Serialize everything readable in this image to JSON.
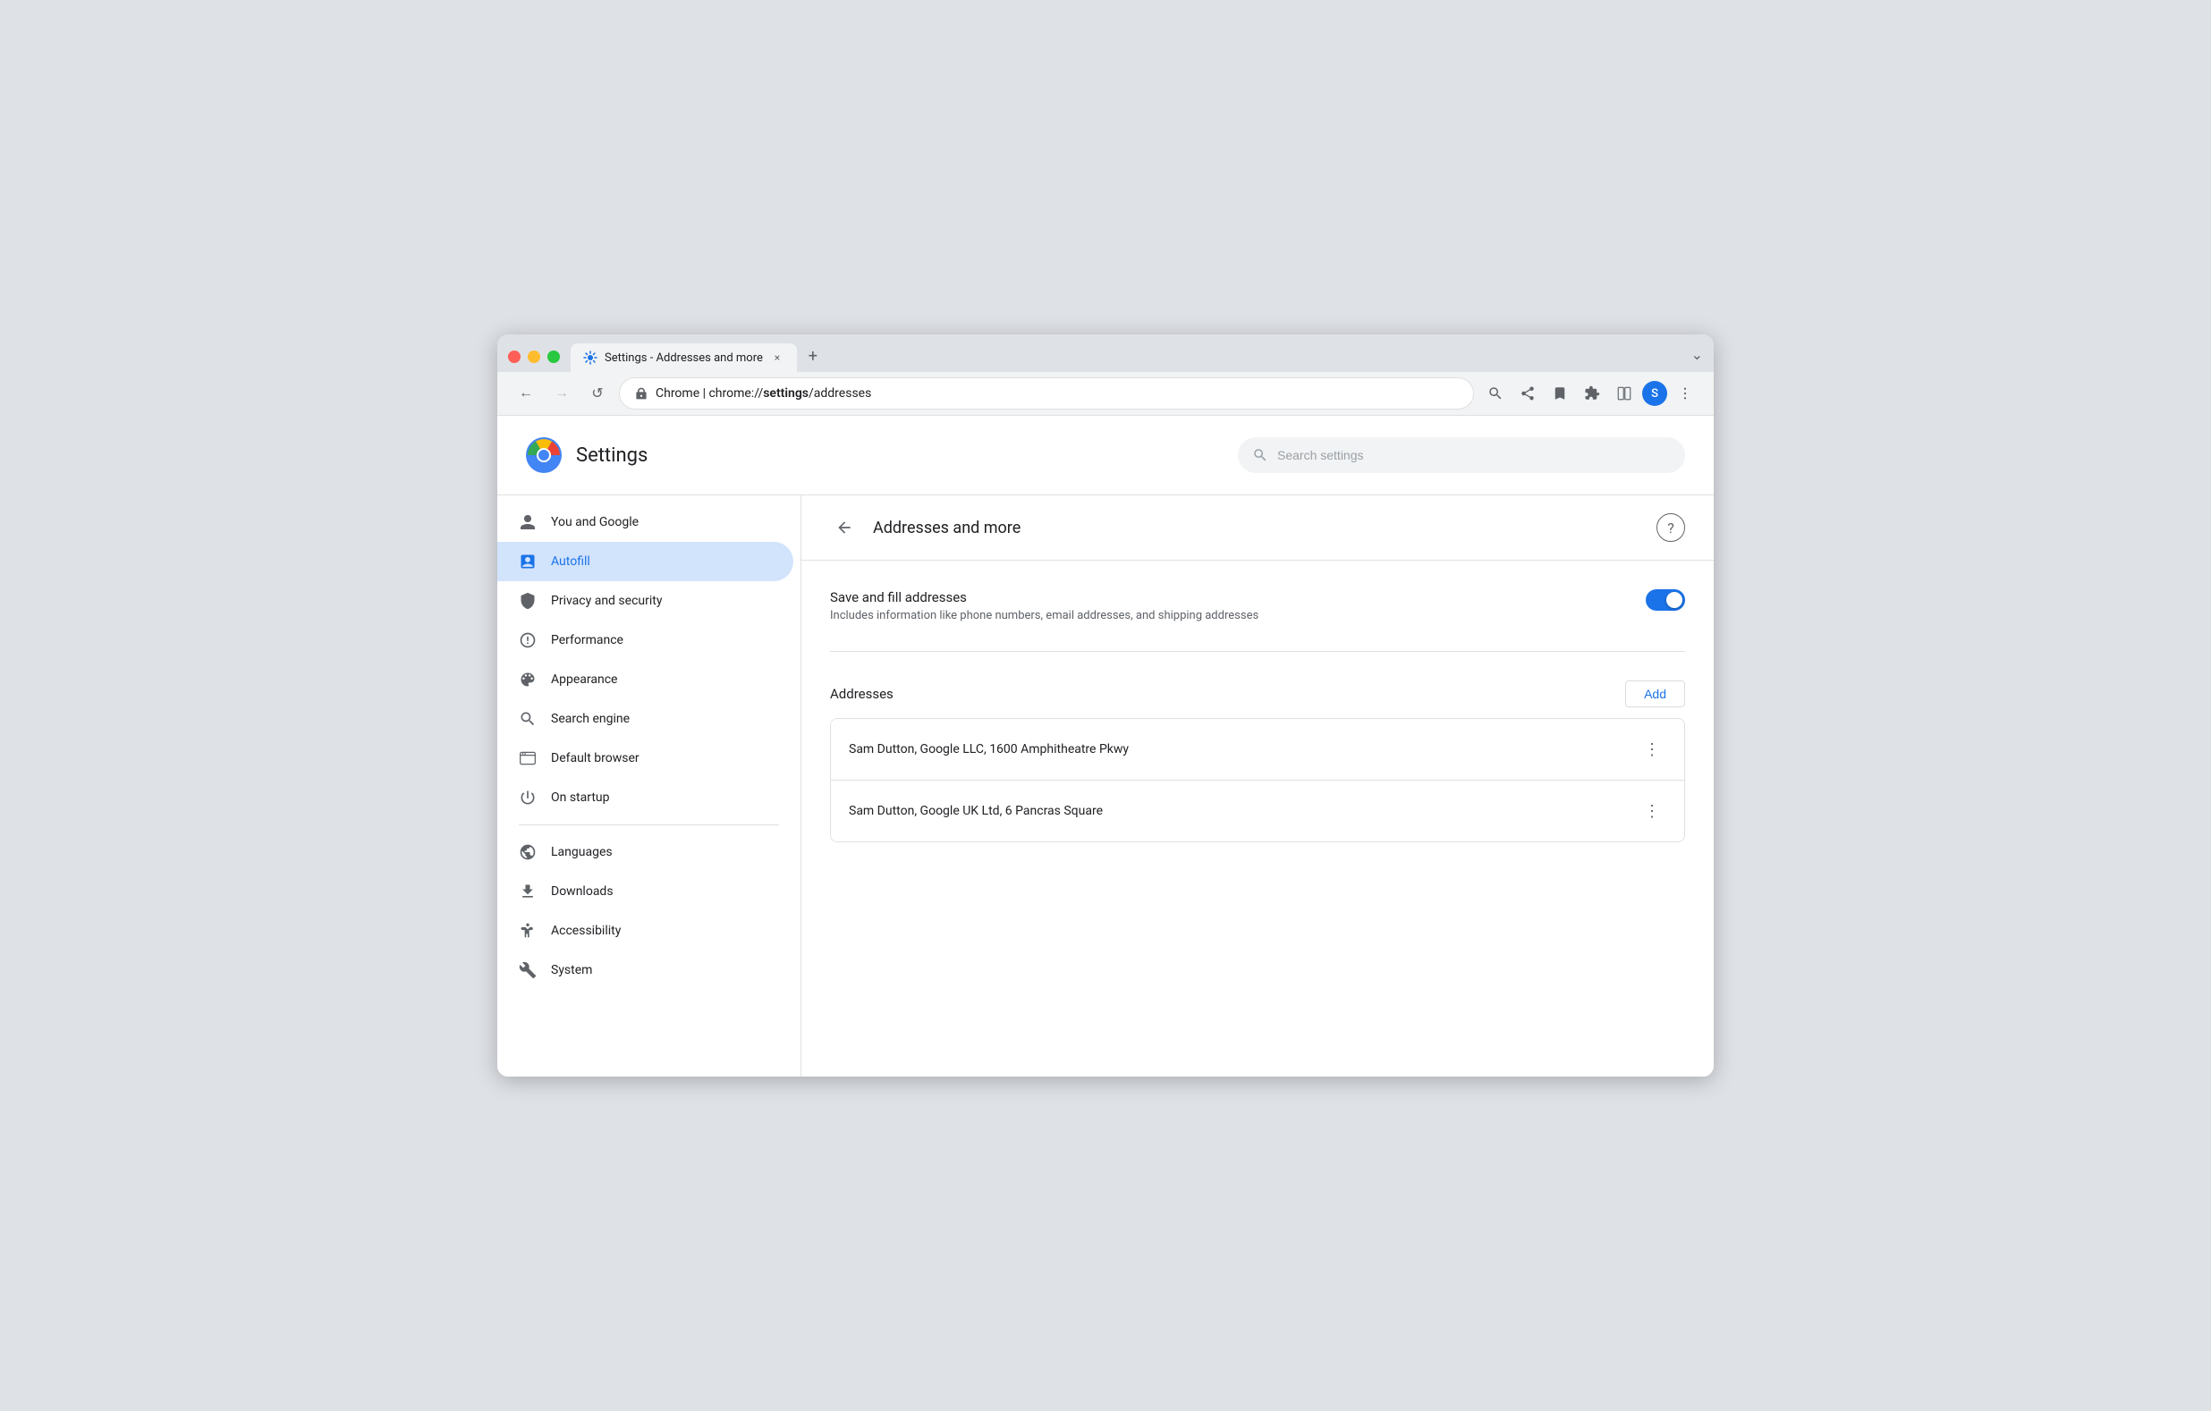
{
  "browser": {
    "tab_title": "Settings - Addresses and more",
    "tab_close_label": "×",
    "new_tab_label": "+",
    "dropdown_label": "⌄",
    "url_protocol": "Chrome  |  ",
    "url_path": "chrome://settings/addresses",
    "url_bold": "settings",
    "nav": {
      "back_label": "←",
      "forward_label": "→",
      "refresh_label": "↺"
    },
    "toolbar_icons": [
      "search",
      "share",
      "star",
      "puzzle",
      "window",
      "menu"
    ],
    "avatar_letter": "S"
  },
  "settings": {
    "logo_alt": "Chrome",
    "title": "Settings",
    "search_placeholder": "Search settings",
    "sidebar": {
      "items": [
        {
          "id": "you-and-google",
          "label": "You and Google",
          "icon": "person",
          "active": false
        },
        {
          "id": "autofill",
          "label": "Autofill",
          "icon": "autofill",
          "active": true
        },
        {
          "id": "privacy-security",
          "label": "Privacy and security",
          "icon": "shield",
          "active": false
        },
        {
          "id": "performance",
          "label": "Performance",
          "icon": "gauge",
          "active": false
        },
        {
          "id": "appearance",
          "label": "Appearance",
          "icon": "palette",
          "active": false
        },
        {
          "id": "search-engine",
          "label": "Search engine",
          "icon": "search",
          "active": false
        },
        {
          "id": "default-browser",
          "label": "Default browser",
          "icon": "browser",
          "active": false
        },
        {
          "id": "on-startup",
          "label": "On startup",
          "icon": "startup",
          "active": false
        }
      ],
      "items2": [
        {
          "id": "languages",
          "label": "Languages",
          "icon": "globe",
          "active": false
        },
        {
          "id": "downloads",
          "label": "Downloads",
          "icon": "download",
          "active": false
        },
        {
          "id": "accessibility",
          "label": "Accessibility",
          "icon": "accessibility",
          "active": false
        },
        {
          "id": "system",
          "label": "System",
          "icon": "wrench",
          "active": false
        }
      ]
    },
    "content": {
      "back_btn_label": "←",
      "page_title": "Addresses and more",
      "help_label": "?",
      "toggle_label": "Save and fill addresses",
      "toggle_desc": "Includes information like phone numbers, email addresses, and shipping addresses",
      "toggle_on": true,
      "addresses_section_label": "Addresses",
      "add_btn_label": "Add",
      "addresses": [
        {
          "id": "addr1",
          "text": "Sam Dutton, Google LLC, 1600 Amphitheatre Pkwy"
        },
        {
          "id": "addr2",
          "text": "Sam Dutton, Google UK Ltd, 6 Pancras Square"
        }
      ],
      "address_menu_icon": "⋮"
    }
  }
}
